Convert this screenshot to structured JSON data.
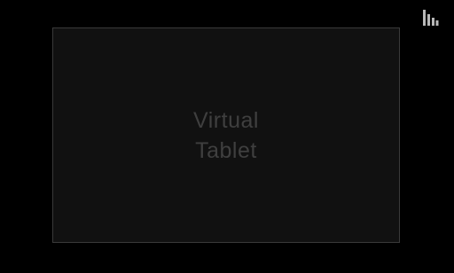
{
  "toolbar": {
    "stats_icon": "bar-chart-icon",
    "icon_color": "#b8b8b8"
  },
  "tablet": {
    "label_line1": "Virtual",
    "label_line2": "Tablet",
    "background_color": "#111111",
    "border_color": "#3a3a3a",
    "label_color": "#3f3f3f"
  },
  "page": {
    "background_color": "#000000"
  }
}
